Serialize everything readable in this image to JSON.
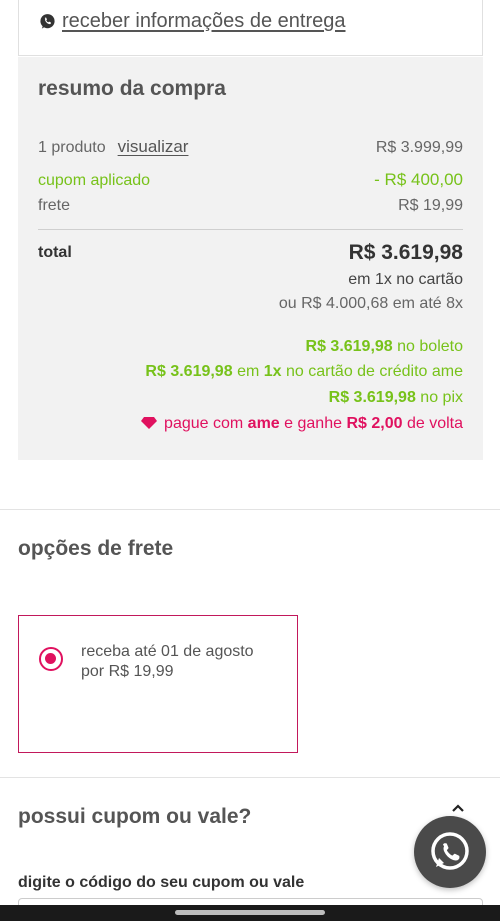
{
  "delivery": {
    "link_label": "receber informações de entrega",
    "icon": "whatsapp-icon"
  },
  "summary": {
    "title": "resumo da compra",
    "products_label": "1 produto",
    "view_label": "visualizar",
    "products_value": "R$ 3.999,99",
    "coupon_label": "cupom aplicado",
    "coupon_value": "- R$ 400,00",
    "shipping_label": "frete",
    "shipping_value": "R$ 19,99",
    "total_label": "total",
    "total_value": "R$ 3.619,98",
    "total_installment": "em 1x no cartão",
    "total_alt": "ou R$ 4.000,68 em até 8x",
    "boleto_amount": "R$ 3.619,98",
    "boleto_text": "no boleto",
    "credit_amount": "R$ 3.619,98",
    "credit_in": "em",
    "credit_times": "1x",
    "credit_text": "no cartão de crédito ame",
    "pix_amount": "R$ 3.619,98",
    "pix_text": "no pix",
    "ame_prefix": "pague com",
    "ame_brand": "ame",
    "ame_middle": "e ganhe",
    "ame_cashback": "R$ 2,00",
    "ame_suffix": "de volta"
  },
  "shipping_options": {
    "title": "opções de frete",
    "option_line1": "receba até 01 de agosto",
    "option_line2": "por R$ 19,99",
    "selected": true
  },
  "coupon": {
    "title": "possui cupom ou vale?",
    "input_label": "digite o código do seu cupom ou vale",
    "input_value": ""
  },
  "colors": {
    "green": "#77c21a",
    "pink": "#e0115f",
    "selected_border": "#c2185b"
  }
}
